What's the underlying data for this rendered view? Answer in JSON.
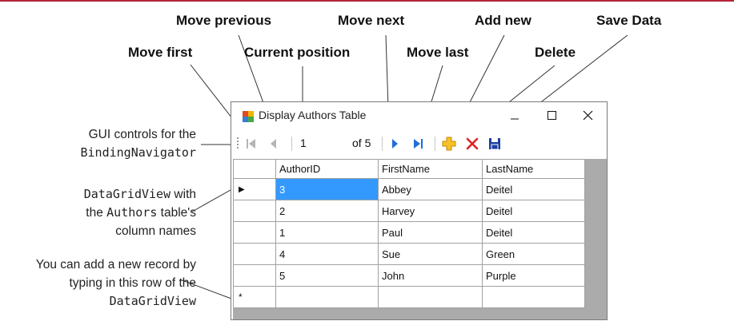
{
  "callouts": {
    "move_previous": "Move previous",
    "move_next": "Move next",
    "add_new": "Add new",
    "save_data": "Save Data",
    "move_first": "Move first",
    "current_position": "Current position",
    "move_last": "Move last",
    "delete": "Delete"
  },
  "side_notes": {
    "gui_line1": "GUI controls for the",
    "gui_line2": "BindingNavigator",
    "dgv_line1_mono": "DataGridView",
    "dgv_line1_rest": " with",
    "dgv_line2_pre": "the ",
    "dgv_line2_mono": "Authors",
    "dgv_line2_post": " table's",
    "dgv_line3": "column names",
    "new_line1": "You can add a new record by",
    "new_line2": "typing in this row of the",
    "new_line3": "DataGridView"
  },
  "window": {
    "title": "Display Authors Table",
    "position_value": "1",
    "of_label": "of 5"
  },
  "grid": {
    "columns": [
      "AuthorID",
      "FirstName",
      "LastName"
    ],
    "rows": [
      [
        "3",
        "Abbey",
        "Deitel"
      ],
      [
        "2",
        "Harvey",
        "Deitel"
      ],
      [
        "1",
        "Paul",
        "Deitel"
      ],
      [
        "4",
        "Sue",
        "Green"
      ],
      [
        "5",
        "John",
        "Purple"
      ]
    ],
    "current_row_marker": "▶",
    "new_row_marker": "*"
  },
  "colors": {
    "accent_line": "#b0243a",
    "selection": "#3399ff",
    "nav_blue": "#1e6fd9",
    "delete_red": "#e02020",
    "add_yellow": "#f0b400"
  },
  "icons": [
    "app-icon",
    "minimize-icon",
    "maximize-icon",
    "close-icon",
    "grip-icon",
    "move-first-icon",
    "move-previous-icon",
    "move-next-icon",
    "move-last-icon",
    "add-new-icon",
    "delete-icon",
    "save-icon"
  ]
}
